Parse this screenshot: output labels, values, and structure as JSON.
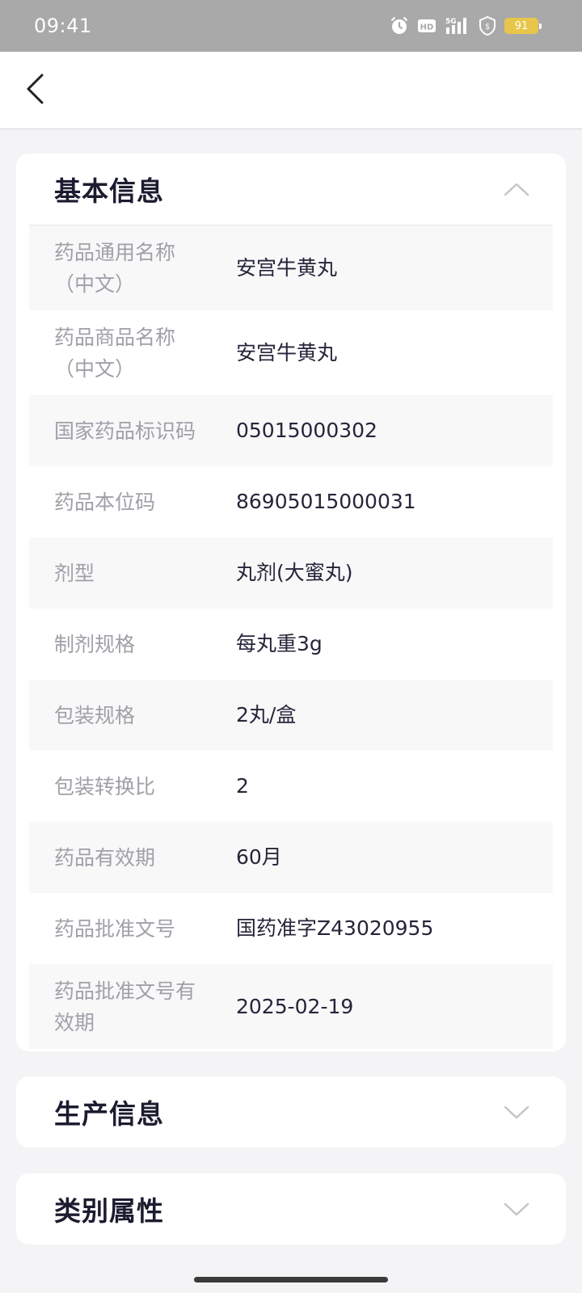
{
  "status_bar": {
    "time": "09:41",
    "battery": "91",
    "icons": [
      "alarm-icon",
      "hd-icon",
      "signal-5g-icon",
      "shield-icon",
      "battery-icon"
    ]
  },
  "sections": {
    "basic": {
      "title": "基本信息",
      "expanded": true,
      "rows": [
        {
          "label_line1": "药品通用名称",
          "label_line2": "（中文）",
          "value": "安宫牛黄丸"
        },
        {
          "label_line1": "药品商品名称",
          "label_line2": "（中文）",
          "value": "安宫牛黄丸"
        },
        {
          "label_line1": "国家药品标识码",
          "label_line2": "",
          "value": "05015000302"
        },
        {
          "label_line1": "药品本位码",
          "label_line2": "",
          "value": "86905015000031"
        },
        {
          "label_line1": "剂型",
          "label_line2": "",
          "value": "丸剂(大蜜丸)"
        },
        {
          "label_line1": "制剂规格",
          "label_line2": "",
          "value": "每丸重3g"
        },
        {
          "label_line1": "包装规格",
          "label_line2": "",
          "value": "2丸/盒"
        },
        {
          "label_line1": "包装转换比",
          "label_line2": "",
          "value": "2"
        },
        {
          "label_line1": "药品有效期",
          "label_line2": "",
          "value": "60月"
        },
        {
          "label_line1": "药品批准文号",
          "label_line2": "",
          "value": "国药准字Z43020955"
        },
        {
          "label_line1": "药品批准文号有",
          "label_line2": "效期",
          "value": "2025-02-19"
        }
      ]
    },
    "production": {
      "title": "生产信息",
      "expanded": false
    },
    "category": {
      "title": "类别属性",
      "expanded": false
    }
  }
}
